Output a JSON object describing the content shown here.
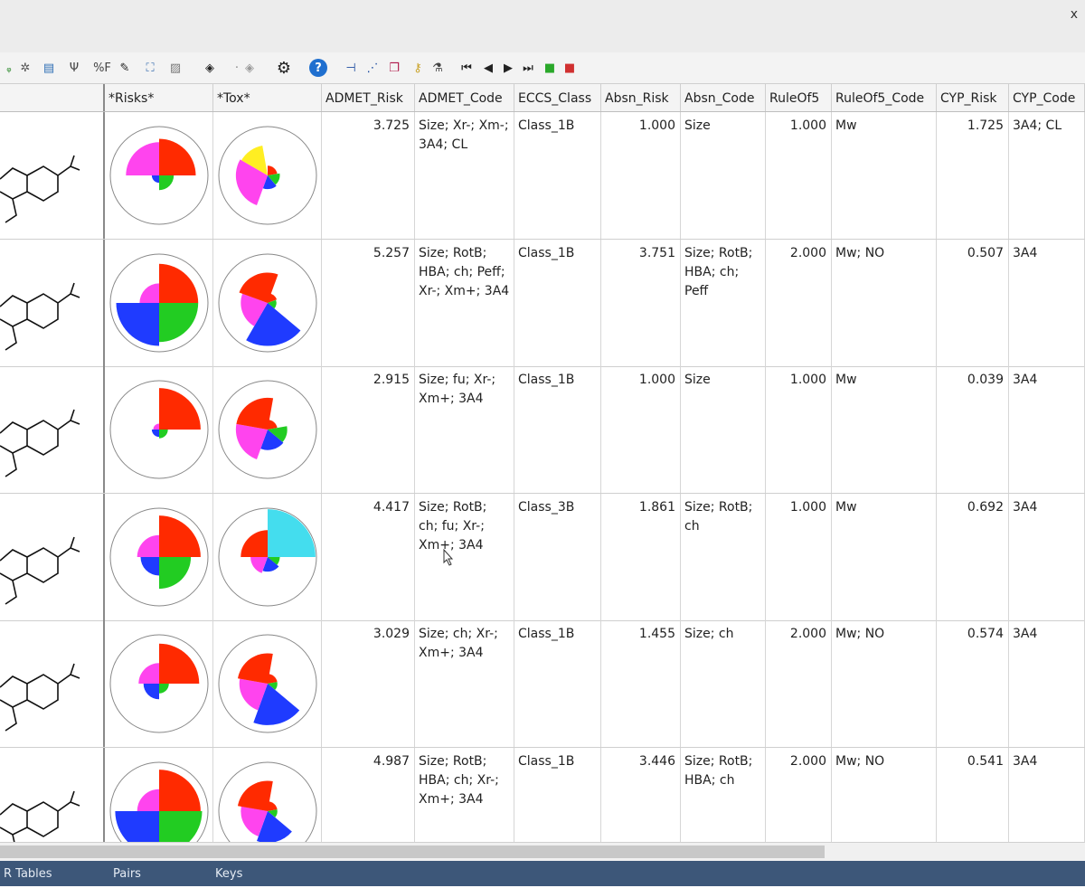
{
  "window": {
    "close_glyph": "x"
  },
  "toolbar": [
    {
      "name": "tool-green-icon",
      "glyph": "ᵩ",
      "color": "#2e8b2e"
    },
    {
      "name": "tool-asterisk-icon",
      "glyph": "✲",
      "color": "#555"
    },
    {
      "name": "tool-image-icon",
      "glyph": "▤",
      "color": "#2f6fb5"
    },
    {
      "name": "tool-fork-icon",
      "glyph": "Ψ",
      "color": "#444"
    },
    {
      "name": "tool-percent-f-icon",
      "glyph": "%F",
      "color": "#444"
    },
    {
      "name": "tool-eraser-icon",
      "glyph": "✎",
      "color": "#222"
    },
    {
      "name": "tool-chart-icon",
      "glyph": "⛶",
      "color": "#3a6fb0"
    },
    {
      "name": "tool-plot-icon",
      "glyph": "▨",
      "color": "#777"
    },
    {
      "name": "tool-cube-icon",
      "glyph": "◈",
      "color": "#222"
    },
    {
      "name": "tool-dot-icon",
      "glyph": "·",
      "color": "#888"
    },
    {
      "name": "tool-cube-gray-icon",
      "glyph": "◈",
      "color": "#999"
    },
    {
      "name": "gear-icon",
      "glyph": "⚙",
      "color": "#222"
    },
    {
      "name": "help-icon",
      "glyph": "?",
      "color": "#ffffff"
    },
    {
      "name": "tool-tree-icon",
      "glyph": "⊣",
      "color": "#1e4da0"
    },
    {
      "name": "tool-scatter-icon",
      "glyph": "⋰",
      "color": "#1e4da0"
    },
    {
      "name": "tool-copy-icon",
      "glyph": "❐",
      "color": "#b0184a"
    },
    {
      "name": "key-icon",
      "glyph": "⚷",
      "color": "#c9a227"
    },
    {
      "name": "flask-icon",
      "glyph": "⚗",
      "color": "#444"
    },
    {
      "name": "first-page-icon",
      "glyph": "⏮",
      "color": "#222"
    },
    {
      "name": "prev-icon",
      "glyph": "◀",
      "color": "#222"
    },
    {
      "name": "next-icon",
      "glyph": "▶",
      "color": "#222"
    },
    {
      "name": "last-page-icon",
      "glyph": "⏭",
      "color": "#222"
    },
    {
      "name": "green-square-icon",
      "glyph": "■",
      "color": "#2aa82a"
    },
    {
      "name": "red-square-icon",
      "glyph": "■",
      "color": "#d03030"
    }
  ],
  "columns": [
    {
      "label": ""
    },
    {
      "label": "*Risks*"
    },
    {
      "label": "*Tox*"
    },
    {
      "label": "ADMET_Risk"
    },
    {
      "label": "ADMET_Code"
    },
    {
      "label": "ECCS_Class"
    },
    {
      "label": "Absn_Risk"
    },
    {
      "label": "Absn_Code"
    },
    {
      "label": "RuleOf5"
    },
    {
      "label": "RuleOf5_Code"
    },
    {
      "label": "CYP_Risk"
    },
    {
      "label": "CYP_Code"
    }
  ],
  "rows": [
    {
      "admet_risk": "3.725",
      "admet_code": "Size; Xr-; Xm-; 3A4; CL",
      "eccs": "Class_1B",
      "absn_risk": "1.000",
      "absn_code": "Size",
      "ro5": "1.000",
      "ro5_code": "Mw",
      "cyp_risk": "1.725",
      "cyp_code": "3A4; CL",
      "risks": [
        {
          "start": -90,
          "end": 0,
          "r": 0.75,
          "color": "#ff2a00"
        },
        {
          "start": 0,
          "end": 90,
          "r": 0.3,
          "color": "#22cc22"
        },
        {
          "start": 90,
          "end": 180,
          "r": 0.15,
          "color": "#1f3bff"
        },
        {
          "start": 180,
          "end": 270,
          "r": 0.68,
          "color": "#ff44ee"
        }
      ],
      "tox": [
        {
          "start": -90,
          "end": -10,
          "r": 0.2,
          "color": "#ff2a00"
        },
        {
          "start": -10,
          "end": 50,
          "r": 0.25,
          "color": "#22cc22"
        },
        {
          "start": 50,
          "end": 110,
          "r": 0.28,
          "color": "#1f3bff"
        },
        {
          "start": 110,
          "end": 210,
          "r": 0.65,
          "color": "#ff44ee"
        },
        {
          "start": 210,
          "end": 260,
          "r": 0.62,
          "color": "#ffee22"
        }
      ]
    },
    {
      "admet_risk": "5.257",
      "admet_code": "Size; RotB; HBA; ch; Peff; Xr-; Xm+; 3A4",
      "eccs": "Class_1B",
      "absn_risk": "3.751",
      "absn_code": "Size; RotB; HBA; ch; Peff",
      "ro5": "2.000",
      "ro5_code": "Mw; NO",
      "cyp_risk": "0.507",
      "cyp_code": "3A4",
      "risks": [
        {
          "start": -90,
          "end": 0,
          "r": 0.8,
          "color": "#ff2a00"
        },
        {
          "start": 0,
          "end": 90,
          "r": 0.8,
          "color": "#22cc22"
        },
        {
          "start": 90,
          "end": 180,
          "r": 0.88,
          "color": "#1f3bff"
        },
        {
          "start": 180,
          "end": 270,
          "r": 0.4,
          "color": "#ff44ee"
        }
      ],
      "tox": [
        {
          "start": -90,
          "end": -20,
          "r": 0.2,
          "color": "#ff2a00"
        },
        {
          "start": -20,
          "end": 40,
          "r": 0.18,
          "color": "#22cc22"
        },
        {
          "start": 40,
          "end": 120,
          "r": 0.88,
          "color": "#1f3bff"
        },
        {
          "start": 120,
          "end": 200,
          "r": 0.55,
          "color": "#ff44ee"
        },
        {
          "start": 200,
          "end": 290,
          "r": 0.62,
          "color": "#ff2a00"
        }
      ]
    },
    {
      "admet_risk": "2.915",
      "admet_code": "Size; fu; Xr-; Xm+; 3A4",
      "eccs": "Class_1B",
      "absn_risk": "1.000",
      "absn_code": "Size",
      "ro5": "1.000",
      "ro5_code": "Mw",
      "cyp_risk": "0.039",
      "cyp_code": "3A4",
      "risks": [
        {
          "start": -90,
          "end": 0,
          "r": 0.85,
          "color": "#ff2a00"
        },
        {
          "start": 0,
          "end": 90,
          "r": 0.18,
          "color": "#22cc22"
        },
        {
          "start": 90,
          "end": 180,
          "r": 0.15,
          "color": "#1f3bff"
        },
        {
          "start": 180,
          "end": 270,
          "r": 0.12,
          "color": "#ff44ee"
        }
      ],
      "tox": [
        {
          "start": -90,
          "end": -10,
          "r": 0.2,
          "color": "#ff2a00"
        },
        {
          "start": -10,
          "end": 40,
          "r": 0.4,
          "color": "#22cc22"
        },
        {
          "start": 40,
          "end": 110,
          "r": 0.42,
          "color": "#1f3bff"
        },
        {
          "start": 110,
          "end": 190,
          "r": 0.65,
          "color": "#ff44ee"
        },
        {
          "start": 190,
          "end": 280,
          "r": 0.65,
          "color": "#ff2a00"
        }
      ]
    },
    {
      "admet_risk": "4.417",
      "admet_code": "Size; RotB; ch; fu; Xr-; Xm+; 3A4",
      "eccs": "Class_3B",
      "absn_risk": "1.861",
      "absn_code": "Size; RotB; ch",
      "ro5": "1.000",
      "ro5_code": "Mw",
      "cyp_risk": "0.692",
      "cyp_code": "3A4",
      "risks": [
        {
          "start": -90,
          "end": 0,
          "r": 0.85,
          "color": "#ff2a00"
        },
        {
          "start": 0,
          "end": 90,
          "r": 0.65,
          "color": "#22cc22"
        },
        {
          "start": 90,
          "end": 180,
          "r": 0.38,
          "color": "#1f3bff"
        },
        {
          "start": 180,
          "end": 270,
          "r": 0.45,
          "color": "#ff44ee"
        }
      ],
      "tox": [
        {
          "start": -90,
          "end": -20,
          "r": 0.2,
          "color": "#ff2a00"
        },
        {
          "start": -20,
          "end": 40,
          "r": 0.25,
          "color": "#22cc22"
        },
        {
          "start": 40,
          "end": 110,
          "r": 0.3,
          "color": "#1f3bff"
        },
        {
          "start": 110,
          "end": 180,
          "r": 0.35,
          "color": "#ff44ee"
        },
        {
          "start": 180,
          "end": 270,
          "r": 0.55,
          "color": "#ff2a00"
        },
        {
          "start": 270,
          "end": 360,
          "r": 0.98,
          "color": "#44ddee"
        }
      ]
    },
    {
      "admet_risk": "3.029",
      "admet_code": "Size; ch; Xr-; Xm+; 3A4",
      "eccs": "Class_1B",
      "absn_risk": "1.455",
      "absn_code": "Size; ch",
      "ro5": "2.000",
      "ro5_code": "Mw; NO",
      "cyp_risk": "0.574",
      "cyp_code": "3A4",
      "risks": [
        {
          "start": -90,
          "end": 0,
          "r": 0.82,
          "color": "#ff2a00"
        },
        {
          "start": 0,
          "end": 90,
          "r": 0.2,
          "color": "#22cc22"
        },
        {
          "start": 90,
          "end": 180,
          "r": 0.32,
          "color": "#1f3bff"
        },
        {
          "start": 180,
          "end": 270,
          "r": 0.42,
          "color": "#ff44ee"
        }
      ],
      "tox": [
        {
          "start": -90,
          "end": -10,
          "r": 0.2,
          "color": "#ff2a00"
        },
        {
          "start": -10,
          "end": 40,
          "r": 0.2,
          "color": "#22cc22"
        },
        {
          "start": 40,
          "end": 110,
          "r": 0.85,
          "color": "#1f3bff"
        },
        {
          "start": 110,
          "end": 190,
          "r": 0.58,
          "color": "#ff44ee"
        },
        {
          "start": 190,
          "end": 280,
          "r": 0.62,
          "color": "#ff2a00"
        }
      ]
    },
    {
      "admet_risk": "4.987",
      "admet_code": "Size; RotB; HBA; ch; Xr-; Xm+; 3A4",
      "eccs": "Class_1B",
      "absn_risk": "3.446",
      "absn_code": "Size; RotB; HBA; ch",
      "ro5": "2.000",
      "ro5_code": "Mw; NO",
      "cyp_risk": "0.541",
      "cyp_code": "3A4",
      "risks": [
        {
          "start": -90,
          "end": 0,
          "r": 0.85,
          "color": "#ff2a00"
        },
        {
          "start": 0,
          "end": 90,
          "r": 0.88,
          "color": "#22cc22"
        },
        {
          "start": 90,
          "end": 180,
          "r": 0.9,
          "color": "#1f3bff"
        },
        {
          "start": 180,
          "end": 270,
          "r": 0.45,
          "color": "#ff44ee"
        }
      ],
      "tox": [
        {
          "start": -90,
          "end": -10,
          "r": 0.2,
          "color": "#ff2a00"
        },
        {
          "start": -10,
          "end": 40,
          "r": 0.2,
          "color": "#22cc22"
        },
        {
          "start": 40,
          "end": 110,
          "r": 0.65,
          "color": "#1f3bff"
        },
        {
          "start": 110,
          "end": 190,
          "r": 0.55,
          "color": "#ff44ee"
        },
        {
          "start": 190,
          "end": 280,
          "r": 0.62,
          "color": "#ff2a00"
        }
      ]
    }
  ],
  "tabs": [
    {
      "label": "R Tables"
    },
    {
      "label": "Pairs"
    },
    {
      "label": "Keys"
    }
  ]
}
